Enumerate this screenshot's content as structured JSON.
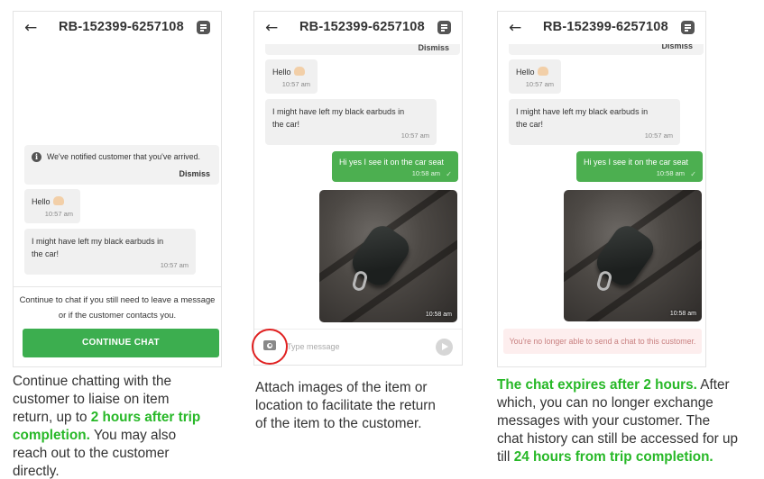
{
  "colors": {
    "accent_green": "#3cae4f",
    "highlight_green": "#27b827",
    "annotation_red": "#e02020"
  },
  "header": {
    "title": "RB-152399-6257108",
    "back_icon": "arrow-left-icon",
    "menu_icon": "document-icon"
  },
  "panel1": {
    "notice": {
      "text": "We've notified customer that you've arrived.",
      "dismiss": "Dismiss"
    },
    "messages": [
      {
        "text": "Hello",
        "time": "10:57 am"
      },
      {
        "line1": "I might have left my black earbuds in",
        "line2": "the car!",
        "time": "10:57 am"
      }
    ],
    "continue_text": {
      "line1": "Continue to chat if you still need to leave a message",
      "line2": "or if the customer contacts you."
    },
    "continue_button": "CONTINUE CHAT",
    "caption": {
      "line1": "Continue chatting with the",
      "line2": "customer to liaise on item",
      "line3_pre": "return, up to ",
      "line3_hl": "2 hours after trip",
      "line4_hl": "completion.",
      "line4_post": " You may also",
      "line5": "reach out to the customer",
      "line6": "directly."
    }
  },
  "panel2": {
    "dismiss": "Dismiss",
    "messages": [
      {
        "text": "Hello",
        "time": "10:57 am"
      },
      {
        "line1": "I might have left my black earbuds in",
        "line2": "the car!",
        "time": "10:57 am"
      }
    ],
    "reply": {
      "text": "Hi yes I see it on the car seat",
      "time": "10:58 am"
    },
    "photo_time": "10:58 am",
    "input_placeholder": "Type message",
    "caption": {
      "line1": "Attach images of the item or",
      "line2": "location to facilitate the return",
      "line3": "of the item to the customer."
    }
  },
  "panel3": {
    "dismiss": "Dismiss",
    "messages": [
      {
        "text": "Hello",
        "time": "10:57 am"
      },
      {
        "line1": "I might have left my black earbuds in",
        "line2": "the car!",
        "time": "10:57 am"
      }
    ],
    "reply": {
      "text": "Hi yes I see it on the car seat",
      "time": "10:58 am"
    },
    "photo_time": "10:58 am",
    "expired_text": "You're no longer able to send a chat to this customer.",
    "caption": {
      "line1_hl": "The chat expires after 2 hours.",
      "line1_post": " After",
      "line2": "which, you can no longer exchange",
      "line3": "messages with your customer. The",
      "line4": "chat history can still be accessed for up",
      "line5_pre": "till ",
      "line5_hl": "24 hours from trip completion."
    }
  }
}
